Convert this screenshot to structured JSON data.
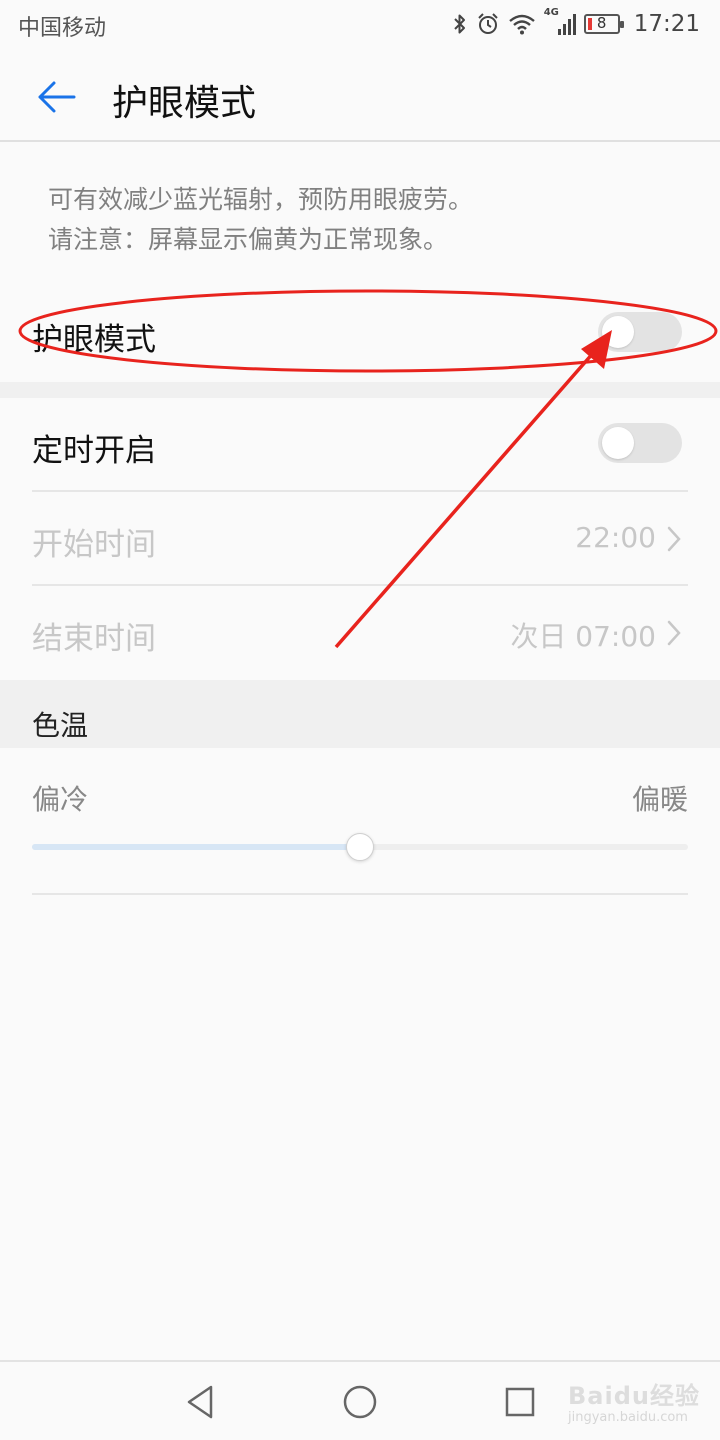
{
  "status_bar": {
    "carrier": "中国移动",
    "network_badge": "4G",
    "battery_level": "8",
    "time": "17:21",
    "icons": [
      "bluetooth-icon",
      "alarm-icon",
      "wifi-icon",
      "signal-icon",
      "battery-icon"
    ]
  },
  "app_bar": {
    "title": "护眼模式",
    "back_icon": "arrow-left-icon"
  },
  "description": {
    "line1": "可有效减少蓝光辐射，预防用眼疲劳。",
    "line2": "请注意：屏幕显示偏黄为正常现象。"
  },
  "eye_mode": {
    "label": "护眼模式",
    "enabled": false
  },
  "schedule": {
    "label": "定时开启",
    "enabled": false,
    "start_time_label": "开始时间",
    "start_time_value": "22:00",
    "end_time_label": "结束时间",
    "end_time_value": "次日 07:00"
  },
  "color_temp": {
    "header": "色温",
    "cool_label": "偏冷",
    "warm_label": "偏暖",
    "slider_fraction": 0.5
  },
  "nav_bar": {
    "icons": [
      "nav-back-icon",
      "nav-home-icon",
      "nav-recents-icon"
    ]
  },
  "watermark": {
    "brand": "Baidu经验",
    "url": "jingyan.baidu.com"
  },
  "colors": {
    "accent_blue": "#1a73e8",
    "annotation_red": "#e8231d",
    "disabled_text": "#c7c7c7"
  }
}
